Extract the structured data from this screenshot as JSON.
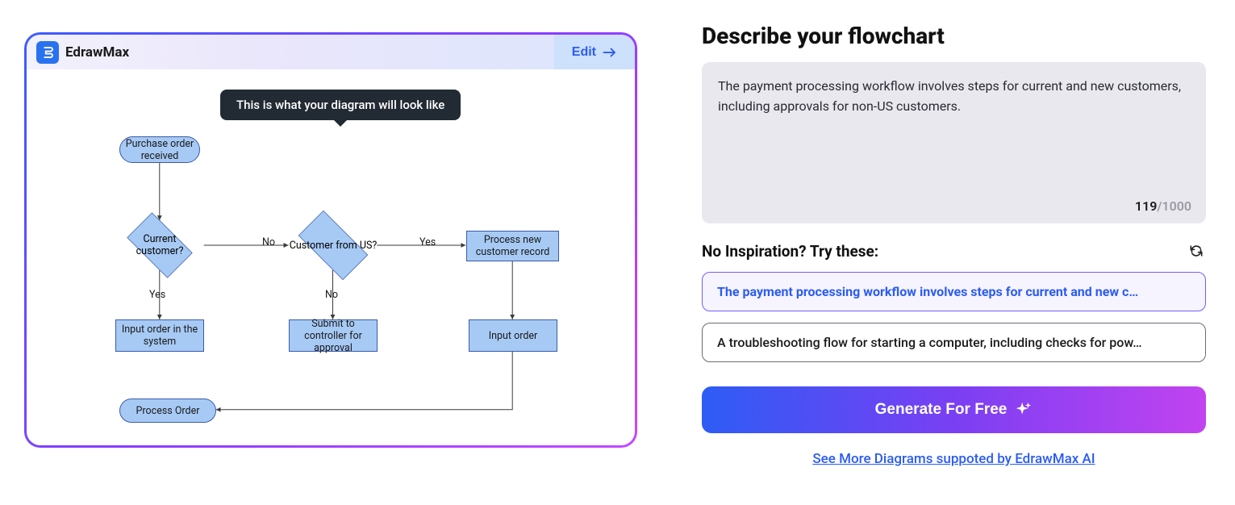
{
  "brand": {
    "name": "EdrawMax"
  },
  "preview": {
    "edit_label": "Edit",
    "tooltip": "This is what your diagram will look like"
  },
  "flowchart": {
    "nodes": {
      "start": "Purchase order received",
      "current_customer": "Current customer?",
      "customer_us": "Customer from US?",
      "process_new": "Process new customer  record",
      "input_system": "Input order in the system",
      "submit_controller": "Submit to controller for approval",
      "input_order": "Input order",
      "process_order": "Process Order"
    },
    "edges": {
      "cc_no": "No",
      "cc_yes": "Yes",
      "us_yes": "Yes",
      "us_no": "No"
    }
  },
  "right": {
    "title": "Describe your flowchart",
    "prompt_text": "The payment processing workflow involves steps for current and new customers, including approvals for non-US customers.",
    "char_current": "119",
    "char_max": "/1000",
    "inspire_label": "No Inspiration? Try these:",
    "suggestions": [
      "The payment processing workflow involves steps for current and new c…",
      "A troubleshooting flow for starting a computer, including checks for pow…"
    ],
    "generate_label": "Generate For Free",
    "see_more": "See More Diagrams suppoted by EdrawMax AI"
  }
}
